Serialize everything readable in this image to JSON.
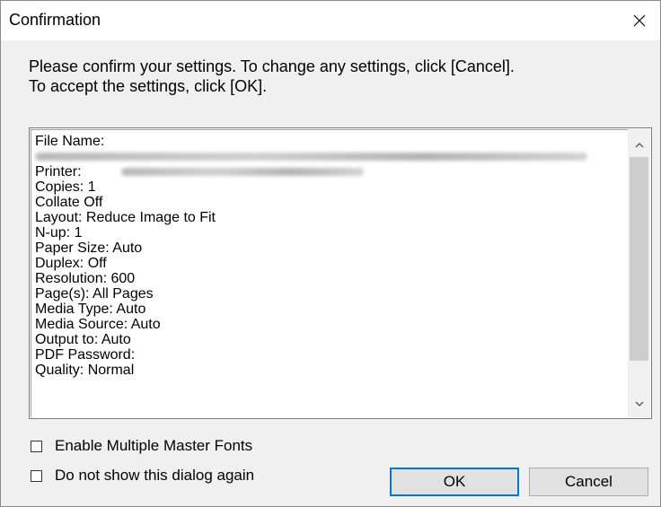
{
  "window": {
    "title": "Confirmation",
    "close_icon": "close-icon"
  },
  "message": {
    "line1": "Please confirm your settings. To change any settings, click [Cancel].",
    "line2": "To accept the settings, click [OK]."
  },
  "settings": {
    "file_name_label": "File Name:",
    "printer_label": "Printer:",
    "items": [
      "Copies: 1",
      "Collate Off",
      "Layout: Reduce Image to Fit",
      "N-up: 1",
      "Paper Size: Auto",
      "Duplex: Off",
      "Resolution: 600",
      "Page(s): All Pages",
      "Media Type: Auto",
      "Media Source: Auto",
      "Output to: Auto",
      "PDF Password:",
      "Quality: Normal"
    ]
  },
  "options": {
    "enable_fonts_label": "Enable Multiple Master Fonts",
    "enable_fonts_checked": false,
    "dont_show_label": "Do not show this dialog again",
    "dont_show_checked": false
  },
  "buttons": {
    "ok_label": "OK",
    "cancel_label": "Cancel"
  },
  "scrollbar": {
    "up_icon": "chevron-up-icon",
    "down_icon": "chevron-down-icon"
  }
}
